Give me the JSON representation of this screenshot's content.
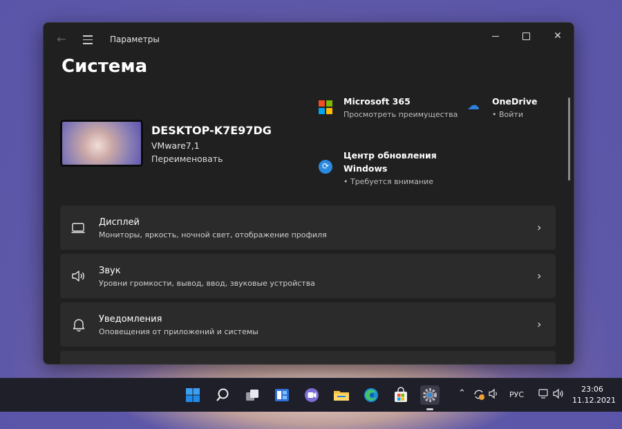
{
  "window": {
    "app_title": "Параметры",
    "page_title": "Система"
  },
  "device": {
    "name": "DESKTOP-K7E97DG",
    "model": "VMware7,1",
    "rename_label": "Переименовать"
  },
  "quick_links": [
    {
      "title": "Microsoft 365",
      "subtitle": "Просмотреть преимущества",
      "icon": "microsoft-logo-icon"
    },
    {
      "title": "OneDrive",
      "subtitle": "• Войти",
      "icon": "onedrive-cloud-icon"
    },
    {
      "title_line1": "Центр обновления",
      "title_line2": "Windows",
      "subtitle": "• Требуется внимание",
      "icon": "windows-update-icon"
    }
  ],
  "settings": [
    {
      "title": "Дисплей",
      "description": "Мониторы, яркость, ночной свет, отображение профиля",
      "icon": "display-icon"
    },
    {
      "title": "Звук",
      "description": "Уровни громкости, вывод, ввод, звуковые устройства",
      "icon": "speaker-icon"
    },
    {
      "title": "Уведомления",
      "description": "Оповещения от приложений и системы",
      "icon": "bell-icon"
    }
  ],
  "taskbar": {
    "language": "РУС",
    "time": "23:06",
    "date": "11.12.2021"
  },
  "colors": {
    "window_bg": "#202020",
    "card_bg": "#2b2b2b",
    "accent": "#2b8ae0",
    "ms_red": "#f25022",
    "ms_green": "#7fba00",
    "ms_blue": "#00a4ef",
    "ms_yellow": "#ffb900"
  }
}
